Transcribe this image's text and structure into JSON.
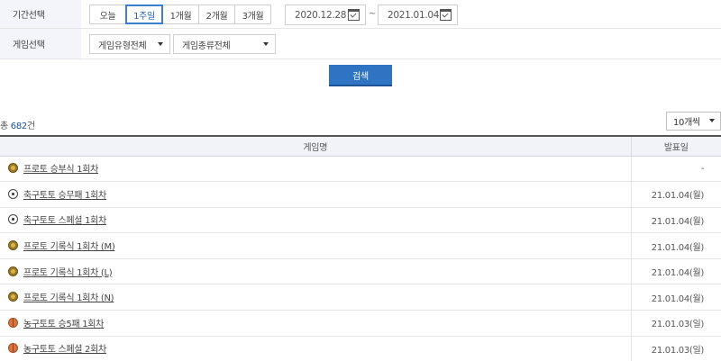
{
  "filter": {
    "period_label": "기간선택",
    "periods": [
      "오늘",
      "1주일",
      "1개월",
      "2개월",
      "3개월"
    ],
    "start_date": "2020.12.28",
    "date_sep": "~",
    "end_date": "2021.01.04",
    "game_label": "게임선택",
    "game_type": "게임유형전체",
    "game_kind": "게임종류전체"
  },
  "search_label": "검색",
  "total": {
    "prefix": "총 ",
    "count": "682",
    "suffix": "건"
  },
  "page_size": "10개씩",
  "table": {
    "headers": [
      "게임명",
      "발표일"
    ],
    "rows": [
      {
        "icon": "proto-icon",
        "name": "프로토 승부식 1회차",
        "date": "-"
      },
      {
        "icon": "soccer-ball-icon",
        "name": "축구토토 승무패 1회차",
        "date": "21.01.04(월)"
      },
      {
        "icon": "soccer-ball-icon",
        "name": "축구토토 스페셜 1회차",
        "date": "21.01.04(월)"
      },
      {
        "icon": "proto-icon",
        "name": "프로토 기록식 1회차 (M)",
        "date": "21.01.04(월)"
      },
      {
        "icon": "proto-icon",
        "name": "프로토 기록식 1회차 (L)",
        "date": "21.01.04(월)"
      },
      {
        "icon": "proto-icon",
        "name": "프로토 기록식 1회차 (N)",
        "date": "21.01.04(월)"
      },
      {
        "icon": "basketball-icon",
        "name": "농구토토 승5패 1회차",
        "date": "21.01.03(일)"
      },
      {
        "icon": "basketball-icon",
        "name": "농구토토 스페셜 2회차",
        "date": "21.01.03(일)"
      }
    ]
  },
  "colors": {
    "accent": "#2f73c3",
    "active_border": "#3b7fd0",
    "label_bg": "#f3f5fa",
    "count": "#1e4fa3"
  }
}
